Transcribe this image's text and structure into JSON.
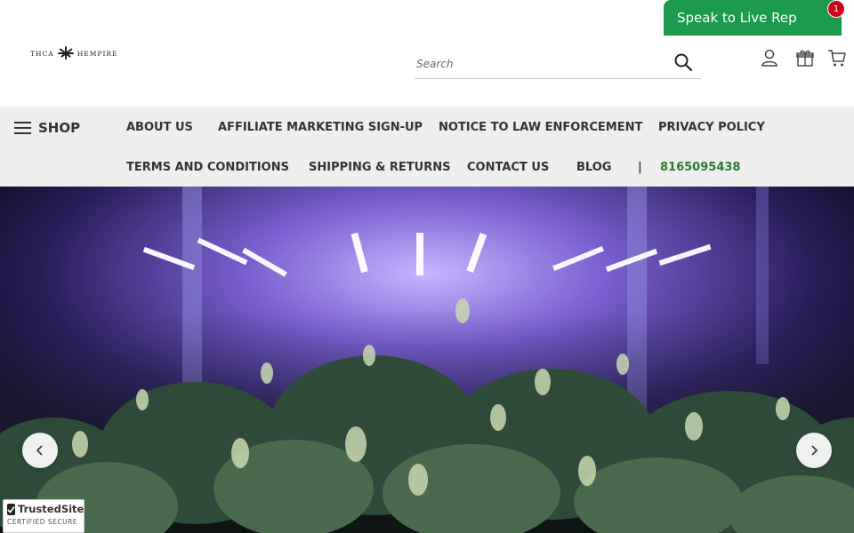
{
  "header": {
    "logo_left": "THCA",
    "logo_right": "HEMPIRE",
    "search_placeholder": "Search",
    "live_rep_label": "Speak to Live Rep",
    "live_rep_badge": "1"
  },
  "nav": {
    "shop_label": "SHOP",
    "row1": [
      "ABOUT US",
      "AFFILIATE MARKETING SIGN-UP",
      "NOTICE TO LAW ENFORCEMENT",
      "PRIVACY POLICY"
    ],
    "row2": [
      "TERMS AND CONDITIONS",
      "SHIPPING & RETURNS",
      "CONTACT US",
      "BLOG"
    ],
    "separator": "|",
    "phone": "8165095438",
    "phone_color": "#2a7a32"
  },
  "badge": {
    "brand": "TrustedSite",
    "tagline": "CERTIFIED SECURE"
  },
  "colors": {
    "live_rep_bg": "#1a9a4a",
    "badge_red": "#d0021b",
    "nav_bg": "#eeeeee"
  },
  "icons": [
    "search-icon",
    "account-icon",
    "gift-icon",
    "cart-icon",
    "chevron-left-icon",
    "chevron-right-icon",
    "checkmark-icon",
    "cannabis-leaf-icon",
    "hamburger-icon"
  ]
}
